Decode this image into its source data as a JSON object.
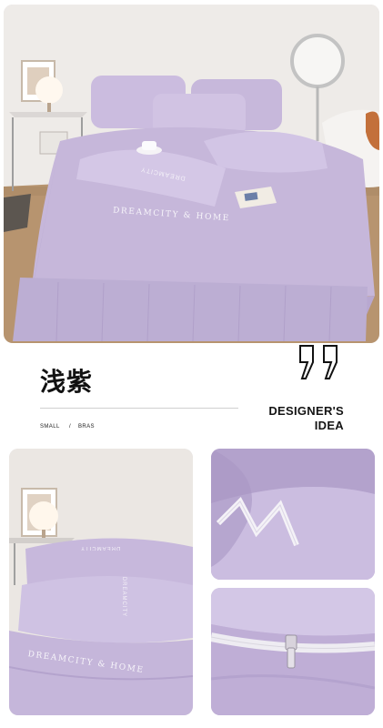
{
  "hero": {
    "embroidery_text": "DREAMCITY & HOME",
    "pillow_text": "DREAMCITY"
  },
  "caption": {
    "color_name": "浅紫",
    "tag_small": "SMALL",
    "tag_sep": "/",
    "tag_bras": "BRAS",
    "designer_line1": "DESIGNER'S",
    "designer_line2": "IDEA"
  },
  "detail_left": {
    "embroidery_text": "DREAMCITY & HOME",
    "pillow_text": "DREAMCITY"
  },
  "colors": {
    "lavender": "#c8b9dc",
    "lavender_dark": "#a995c4",
    "wall": "#ece8e4",
    "floor": "#c9a98a"
  }
}
